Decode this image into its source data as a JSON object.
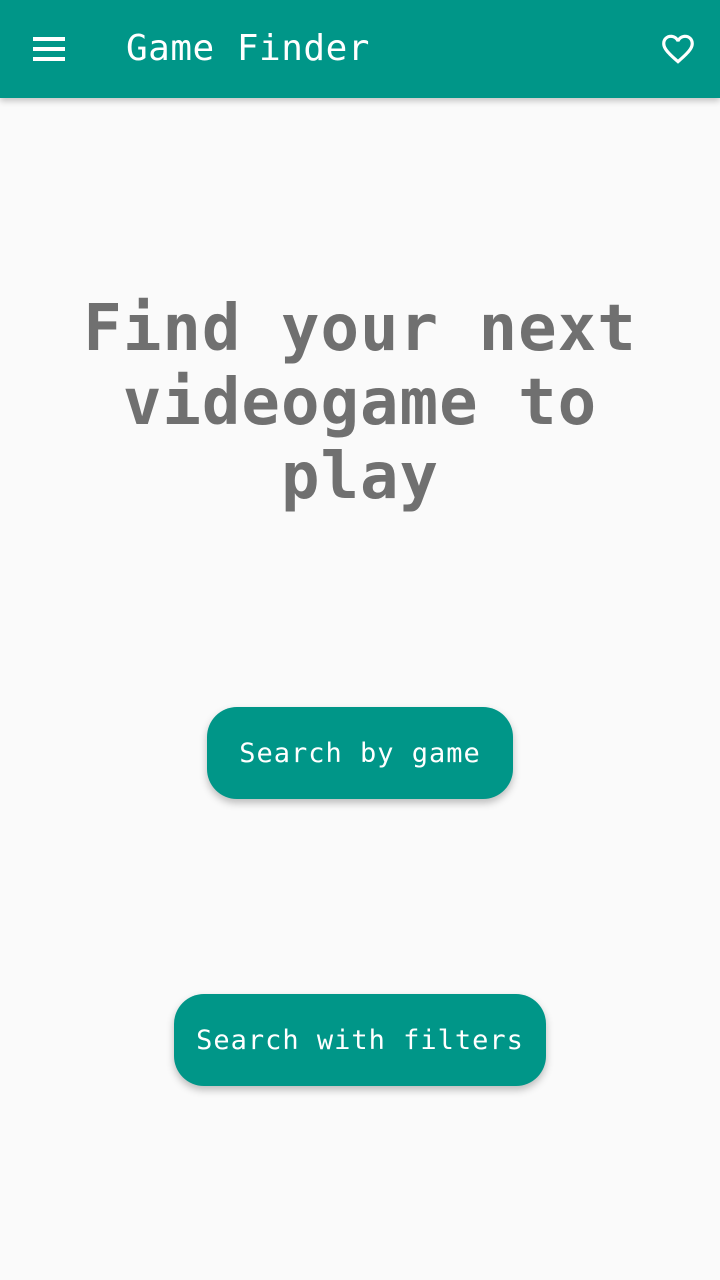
{
  "app_bar": {
    "title": "Game Finder",
    "menu_icon": "hamburger-menu-icon",
    "favorite_icon": "heart-outline-icon",
    "color": "#009688"
  },
  "main": {
    "headline_lines": [
      "Find your next",
      "videogame to",
      "play"
    ],
    "search_by_game_label": "Search by game",
    "search_with_filters_label": "Search with filters"
  },
  "colors": {
    "accent": "#009688",
    "background": "#fafafa",
    "headline_text": "#707070",
    "on_accent": "#ffffff"
  }
}
